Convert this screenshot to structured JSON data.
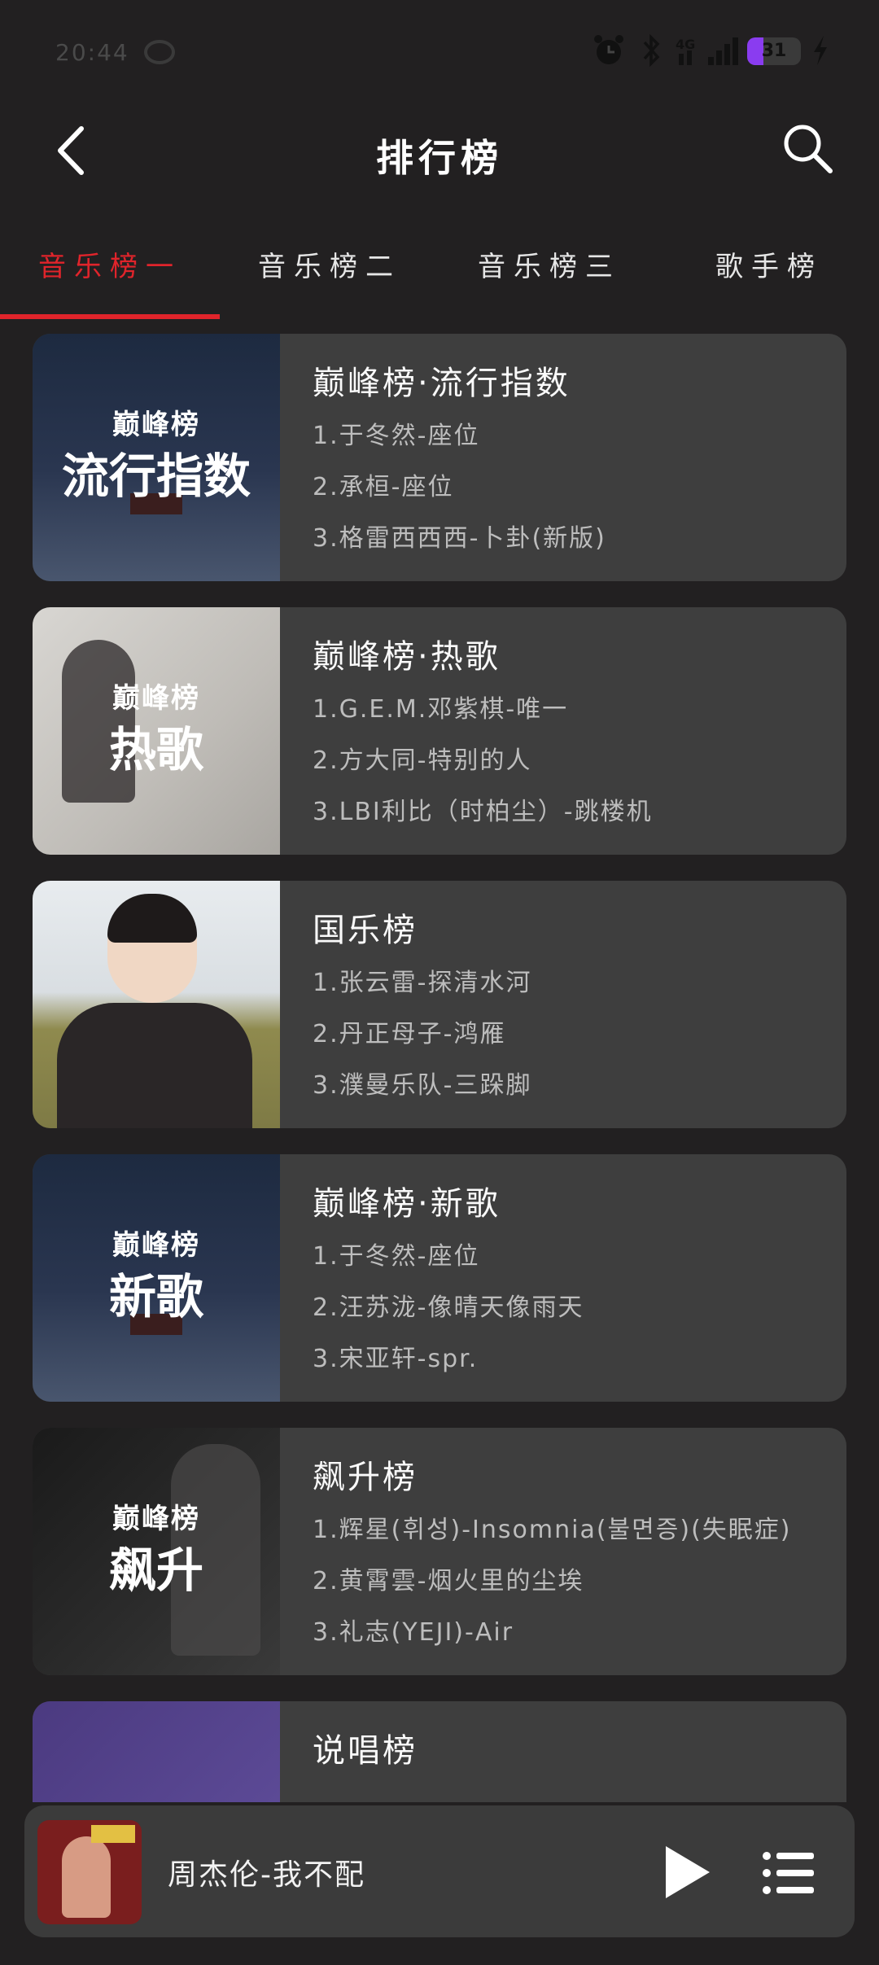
{
  "status": {
    "time": "20:44",
    "battery": "31",
    "battery_level": 0.31,
    "icons": [
      "chat-bubble-icon",
      "alarm-icon",
      "bluetooth-icon",
      "signal-4g-icon",
      "signal-bars-icon",
      "charging-icon"
    ]
  },
  "header": {
    "title": "排行榜",
    "back_icon": "chevron-left-icon",
    "search_icon": "search-icon"
  },
  "tabs": [
    {
      "label": "音乐榜一",
      "active": true
    },
    {
      "label": "音乐榜二",
      "active": false
    },
    {
      "label": "音乐榜三",
      "active": false
    },
    {
      "label": "歌手榜",
      "active": false
    }
  ],
  "colors": {
    "accent": "#e0242b",
    "background": "#222021",
    "card": "#3e3e3e"
  },
  "charts": [
    {
      "title": "巅峰榜·流行指数",
      "cover_brand": "巅峰榜",
      "cover_label": "流行指数",
      "tracks": [
        "1.于冬然-座位",
        "2.承桓-座位",
        "3.格雷西西西-卜卦(新版)"
      ]
    },
    {
      "title": "巅峰榜·热歌",
      "cover_brand": "巅峰榜",
      "cover_label": "热歌",
      "tracks": [
        "1.G.E.M.邓紫棋-唯一",
        "2.方大同-特别的人",
        "3.LBI利比（时柏尘）-跳楼机"
      ]
    },
    {
      "title": "国乐榜",
      "cover_brand": "",
      "cover_label": "",
      "tracks": [
        "1.张云雷-探清水河",
        "2.丹正母子-鸿雁",
        "3.濮曼乐队-三跺脚"
      ]
    },
    {
      "title": "巅峰榜·新歌",
      "cover_brand": "巅峰榜",
      "cover_label": "新歌",
      "tracks": [
        "1.于冬然-座位",
        "2.汪苏泷-像晴天像雨天",
        "3.宋亚轩-spr."
      ]
    },
    {
      "title": "飙升榜",
      "cover_brand": "巅峰榜",
      "cover_label": "飙升",
      "tracks": [
        "1.辉星(휘성)-Insomnia(불면증)(失眠症)",
        "2.黄霄雲-烟火里的尘埃",
        "3.礼志(YEJI)-Air"
      ]
    },
    {
      "title": "说唱榜",
      "cover_brand": "",
      "cover_label": "",
      "tracks": []
    }
  ],
  "player": {
    "now_playing": "周杰伦-我不配",
    "play_icon": "play-icon",
    "queue_icon": "playlist-icon"
  }
}
